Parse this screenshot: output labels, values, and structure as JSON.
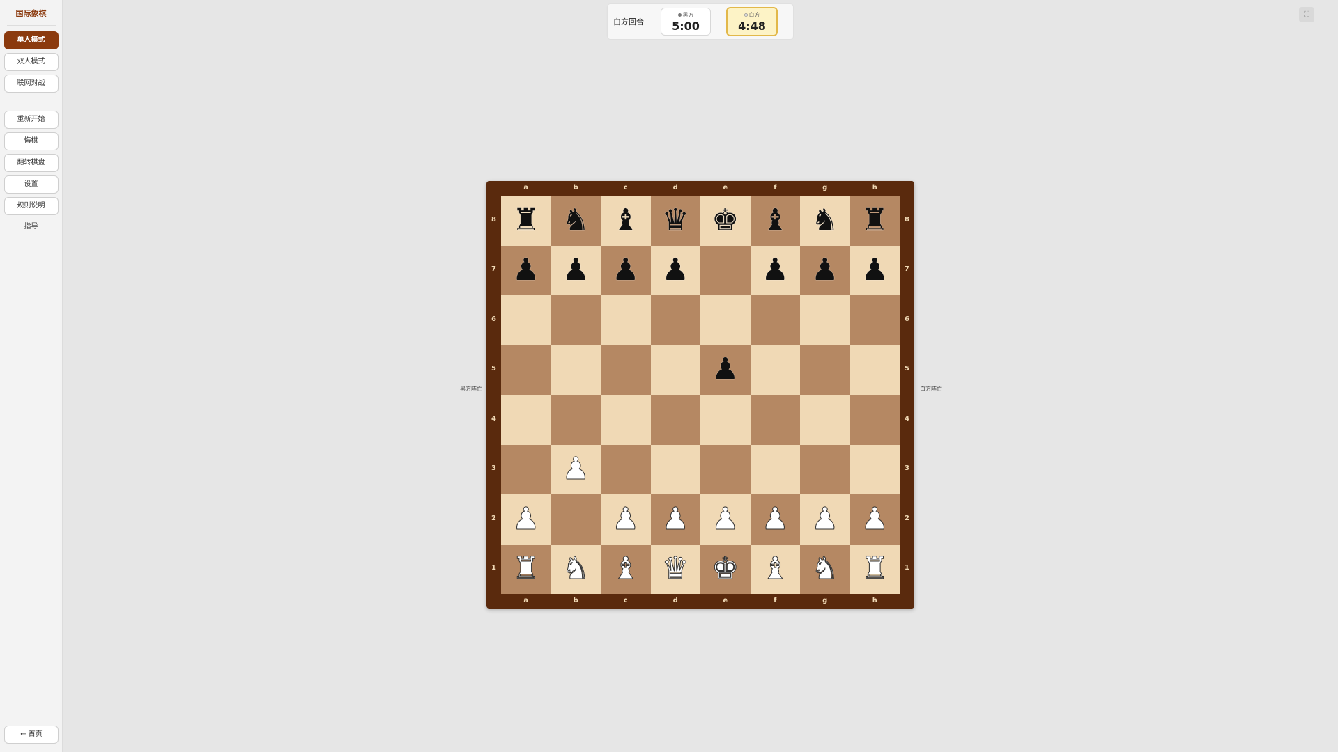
{
  "sidebar": {
    "title": "国际象棋",
    "modes": [
      {
        "label": "单人模式",
        "active": true
      },
      {
        "label": "双人模式",
        "active": false
      },
      {
        "label": "联网对战",
        "active": false
      }
    ],
    "actions": [
      {
        "label": "重新开始"
      },
      {
        "label": "悔棋"
      },
      {
        "label": "翻转棋盘"
      },
      {
        "label": "设置"
      },
      {
        "label": "规则说明"
      }
    ],
    "guide": "指导",
    "home": "← 首页"
  },
  "status": {
    "turn": "白方回合",
    "black_label": "黑方",
    "black_time": "5:00",
    "white_label": "白方",
    "white_time": "4:48",
    "active_side": "white"
  },
  "fullscreen_icon": "fullscreen-icon",
  "board": {
    "files": [
      "a",
      "b",
      "c",
      "d",
      "e",
      "f",
      "g",
      "h"
    ],
    "ranks": [
      "8",
      "7",
      "6",
      "5",
      "4",
      "3",
      "2",
      "1"
    ],
    "position": [
      [
        "r",
        "n",
        "b",
        "q",
        "k",
        "b",
        "n",
        "r"
      ],
      [
        "p",
        "p",
        "p",
        "p",
        "",
        "p",
        "p",
        "p"
      ],
      [
        "",
        "",
        "",
        "",
        "",
        "",
        "",
        ""
      ],
      [
        "",
        "",
        "",
        "",
        "p",
        "",
        "",
        ""
      ],
      [
        "",
        "",
        "",
        "",
        "",
        "",
        "",
        ""
      ],
      [
        "",
        "P",
        "",
        "",
        "",
        "",
        "",
        ""
      ],
      [
        "P",
        "",
        "P",
        "P",
        "P",
        "P",
        "P",
        "P"
      ],
      [
        "R",
        "N",
        "B",
        "Q",
        "K",
        "B",
        "N",
        "R"
      ]
    ],
    "light_color": "#f0d9b5",
    "dark_color": "#b58863",
    "frame_color": "#5a2a0d"
  },
  "captured": {
    "black": "黑方阵亡",
    "white": "白方阵亡"
  },
  "accent_color": "#8b3a0e"
}
